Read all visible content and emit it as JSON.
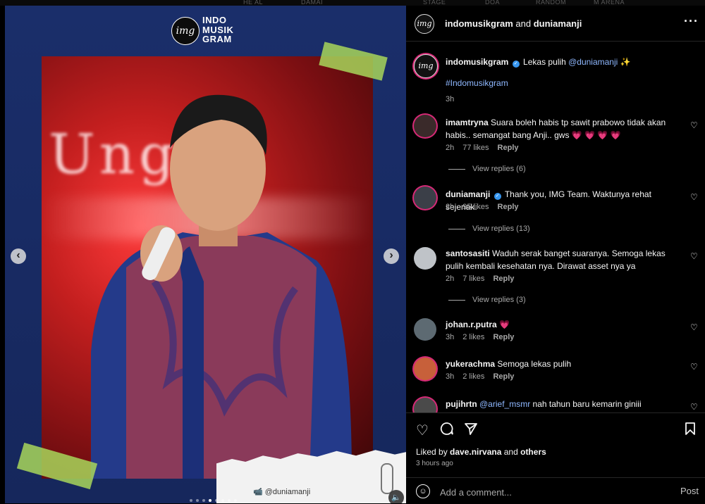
{
  "top_strip": [
    "HE AL",
    "DAMAI",
    "STAGE",
    "DOA",
    "RANDOM",
    "M ARENA"
  ],
  "media": {
    "logo_mark": "img",
    "logo_lines": [
      "INDO",
      "MUSIK",
      "GRAM"
    ],
    "stage_text": "Ungul, ",
    "watermark_handle": "@duniamanji",
    "slide_count": 8,
    "active_slide": 4
  },
  "header": {
    "author": "indomusikgram",
    "joiner": " and ",
    "collaborator": "duniamanji",
    "more_icon": "more-horizontal-icon"
  },
  "caption": {
    "username": "indomusikgram",
    "text": "Lekas pulih ",
    "mention": "@duniamanji",
    "emoji": "✨",
    "hashtag": "#Indomusikgram",
    "time": "3h"
  },
  "comments": [
    {
      "username": "imamtryna",
      "text": "Suara boleh habis tp sawit prabowo tidak akan habis.. semangat bang Anji.. gws ",
      "hearts": "💗 💗 💗 💗",
      "time": "2h",
      "likes": "77 likes",
      "reply": "Reply",
      "view_replies": "View replies (6)"
    },
    {
      "username": "duniamanji",
      "verified": true,
      "text": "Thank you, IMG Team. Waktunya rehat sejenak.",
      "time": "2h",
      "likes": "95 likes",
      "reply": "Reply",
      "view_replies": "View replies (13)"
    },
    {
      "username": "santosasiti",
      "text": "Waduh serak banget suaranya. Semoga lekas pulih kembali kesehatan nya. Dirawat asset nya ya",
      "time": "2h",
      "likes": "7 likes",
      "reply": "Reply",
      "view_replies": "View replies (3)"
    },
    {
      "username": "johan.r.putra",
      "text": "💗",
      "time": "3h",
      "likes": "2 likes",
      "reply": "Reply"
    },
    {
      "username": "yukerachma",
      "text": "Semoga lekas pulih",
      "time": "3h",
      "likes": "2 likes",
      "reply": "Reply"
    },
    {
      "username": "pujihrtn",
      "mention": "@arief_msmr",
      "text": " nah tahun baru kemarin giniii"
    }
  ],
  "actions": {
    "liked_by_prefix": "Liked by ",
    "liked_by_user": "dave.nirvana",
    "liked_by_and": " and ",
    "liked_by_others": "others",
    "time": "3 hours ago"
  },
  "composer": {
    "placeholder": "Add a comment...",
    "post_label": "Post"
  },
  "colors": {
    "accent_blue": "#3797f0",
    "heart": "#ff3b6b",
    "frame_navy": "#1b2f6b",
    "tape_green": "#a8d65a"
  }
}
